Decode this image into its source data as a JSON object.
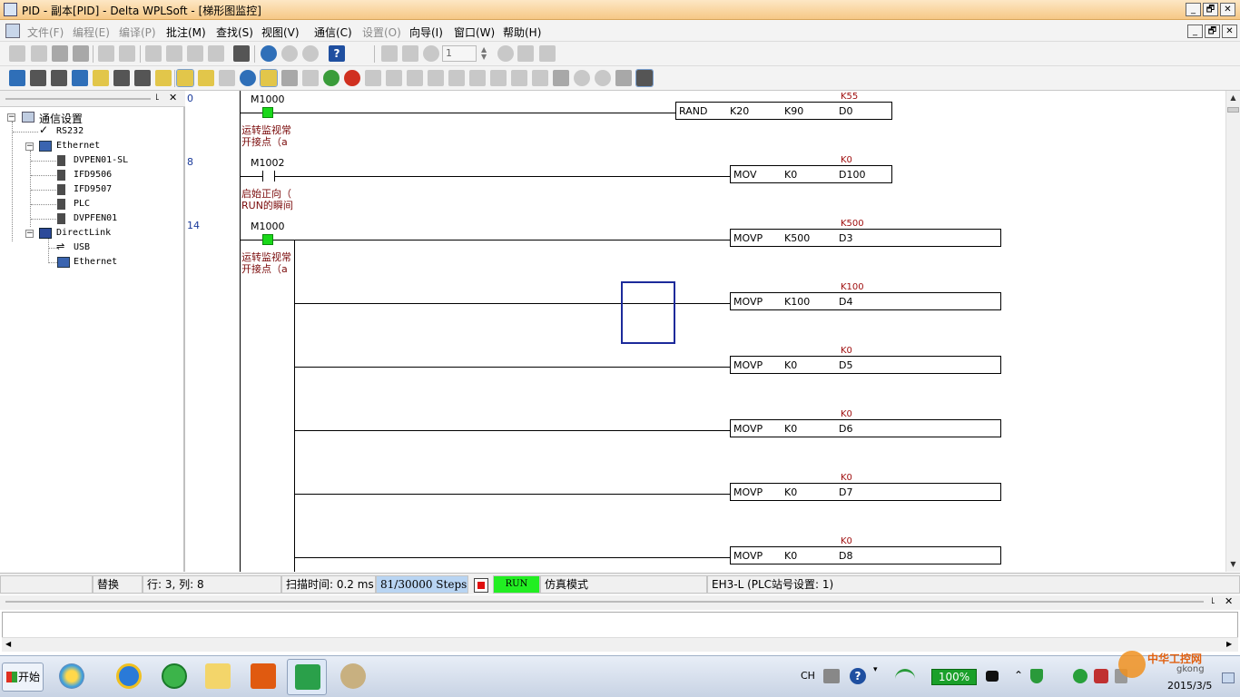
{
  "window": {
    "title": "PID - 副本[PID] - Delta WPLSoft - [梯形图监控]",
    "controls": {
      "minimize": "_",
      "restore": "🗗",
      "close": "✕"
    }
  },
  "menubar": {
    "items": [
      {
        "label": "文件(F)",
        "enabled": false
      },
      {
        "label": "编程(E)",
        "enabled": false
      },
      {
        "label": "编译(P)",
        "enabled": false
      },
      {
        "label": "批注(M)",
        "enabled": true
      },
      {
        "label": "查找(S)",
        "enabled": true
      },
      {
        "label": "视图(V)",
        "enabled": true
      },
      {
        "label": "通信(C)",
        "enabled": true
      },
      {
        "label": "设置(O)",
        "enabled": false
      },
      {
        "label": "向导(I)",
        "enabled": true
      },
      {
        "label": "窗口(W)",
        "enabled": true
      },
      {
        "label": "帮助(H)",
        "enabled": true
      }
    ]
  },
  "toolbar": {
    "step_value": "1"
  },
  "tree": {
    "root": "通信设置",
    "rs232": "RS232",
    "ethernet": "Ethernet",
    "ethernet_children": [
      "DVPEN01-SL",
      "IFD9506",
      "IFD9507",
      "PLC",
      "DVPFEN01"
    ],
    "directlink": "DirectLink",
    "directlink_children": [
      "USB",
      "Ethernet"
    ]
  },
  "ladder": {
    "rungs": [
      {
        "step": "0",
        "contact": "M1000",
        "comment": [
          "运转监视常",
          "开接点（a"
        ],
        "instr": {
          "op": "RAND",
          "a": "K20",
          "b": "K90",
          "c": "D0"
        },
        "monitor": "K55"
      },
      {
        "step": "8",
        "contact": "M1002",
        "comment": [
          "启始正向（",
          "RUN的瞬间"
        ],
        "instr": {
          "op": "MOV",
          "a": "K0",
          "c": "D100"
        },
        "monitor": "K0"
      },
      {
        "step": "14",
        "contact": "M1000",
        "comment": [
          "运转监视常",
          "开接点（a"
        ],
        "instrs": [
          {
            "op": "MOVP",
            "a": "K500",
            "c": "D3",
            "monitor": "K500"
          },
          {
            "op": "MOVP",
            "a": "K100",
            "c": "D4",
            "monitor": "K100"
          },
          {
            "op": "MOVP",
            "a": "K0",
            "c": "D5",
            "monitor": "K0"
          },
          {
            "op": "MOVP",
            "a": "K0",
            "c": "D6",
            "monitor": "K0"
          },
          {
            "op": "MOVP",
            "a": "K0",
            "c": "D7",
            "monitor": "K0"
          },
          {
            "op": "MOVP",
            "a": "K0",
            "c": "D8",
            "monitor": "K0"
          }
        ]
      }
    ]
  },
  "status": {
    "mode": "替换",
    "position": "行: 3, 列: 8",
    "scan_time": "扫描时间: 0.2 ms",
    "steps": "81/30000 Steps",
    "run": "RUN",
    "sim": "仿真模式",
    "plc": "EH3-L (PLC站号设置: 1)"
  },
  "taskbar": {
    "start": "开始",
    "lang": "CH",
    "battery": "100%",
    "date": "2015/3/5",
    "watermark": "中华工控网",
    "watermark_sub": "gkong"
  },
  "colors": {
    "contact_on": "#1ad81a",
    "monitor_value": "#a01010",
    "run_indicator": "#22ee22",
    "steps_cell": "#b8d4f2",
    "cursor": "#1c2a9a"
  }
}
